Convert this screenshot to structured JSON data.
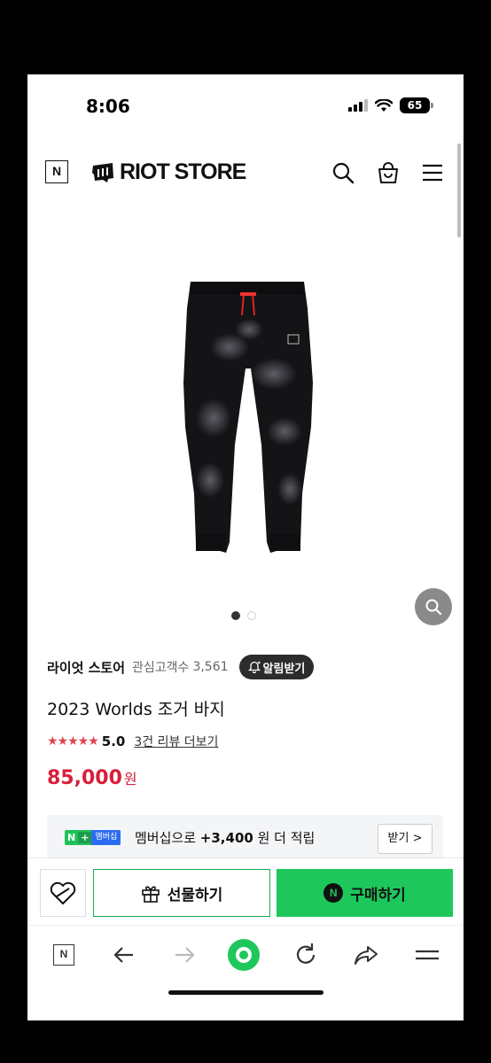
{
  "status_bar": {
    "time": "8:06",
    "battery": "65"
  },
  "header": {
    "n_logo": "N",
    "store_logo": "RIOT STORE"
  },
  "store": {
    "name": "라이엇 스토어",
    "watch_label": "관심고객수",
    "watch_count": "3,561",
    "notify_button": "알림받기"
  },
  "product": {
    "title": "2023 Worlds 조거 바지",
    "stars": "★★★★★",
    "rating": "5.0",
    "review_link": "3건 리뷰 더보기",
    "price": "85,000",
    "currency": "원"
  },
  "membership": {
    "badge_n": "N",
    "badge_plus": "+",
    "badge_label": "멤버십",
    "text_prefix": "멤버십으로",
    "points": "+3,400",
    "text_suffix": "원 더 적립",
    "receive_button": "받기 >"
  },
  "actions": {
    "gift_label": "선물하기",
    "buy_label": "구매하기",
    "buy_icon": "N"
  },
  "nav": {
    "home_label": "N"
  },
  "colors": {
    "accent_green": "#1ec75b",
    "price_red": "#d81f3a",
    "star_red": "#e0454d"
  },
  "icons": [
    "search-icon",
    "shopping-bag-icon",
    "menu-icon",
    "zoom-icon",
    "bell-icon",
    "heart-icon",
    "gift-icon",
    "back-arrow-icon",
    "forward-arrow-icon",
    "home-circle-icon",
    "refresh-icon",
    "share-icon",
    "hamburger-icon"
  ]
}
